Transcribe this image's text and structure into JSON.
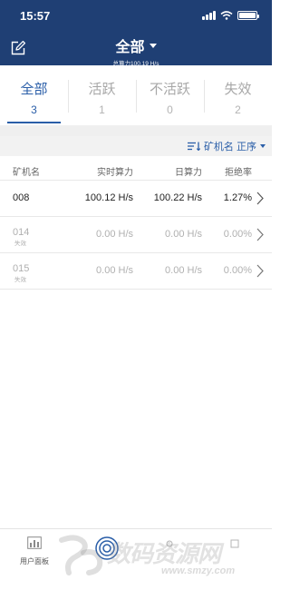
{
  "status_bar": {
    "time": "15:57"
  },
  "header": {
    "title": "全部",
    "subtitle": "总算力100.19 H/s"
  },
  "tabs": [
    {
      "label": "全部",
      "count": "3",
      "active": true
    },
    {
      "label": "活跃",
      "count": "1",
      "active": false
    },
    {
      "label": "不活跃",
      "count": "0",
      "active": false
    },
    {
      "label": "失效",
      "count": "2",
      "active": false
    }
  ],
  "sort": {
    "label": "矿机名 正序"
  },
  "table": {
    "headers": {
      "name": "矿机名",
      "realtime": "实时算力",
      "daily": "日算力",
      "reject": "拒绝率"
    },
    "rows": [
      {
        "name": "008",
        "status": "",
        "realtime": "100.12 H/s",
        "daily": "100.22 H/s",
        "reject": "1.27%"
      },
      {
        "name": "014",
        "status": "失效",
        "realtime": "0.00 H/s",
        "daily": "0.00 H/s",
        "reject": "0.00%"
      },
      {
        "name": "015",
        "status": "失效",
        "realtime": "0.00 H/s",
        "daily": "0.00 H/s",
        "reject": "0.00%"
      }
    ]
  },
  "tabbar": {
    "panel_label": "用户面板"
  },
  "watermark": {
    "text": "数码资源网",
    "url": "www.smzy.com"
  },
  "colors": {
    "header_bg": "#1f3f74",
    "accent": "#2a5ea8",
    "separator": "#efefef"
  }
}
